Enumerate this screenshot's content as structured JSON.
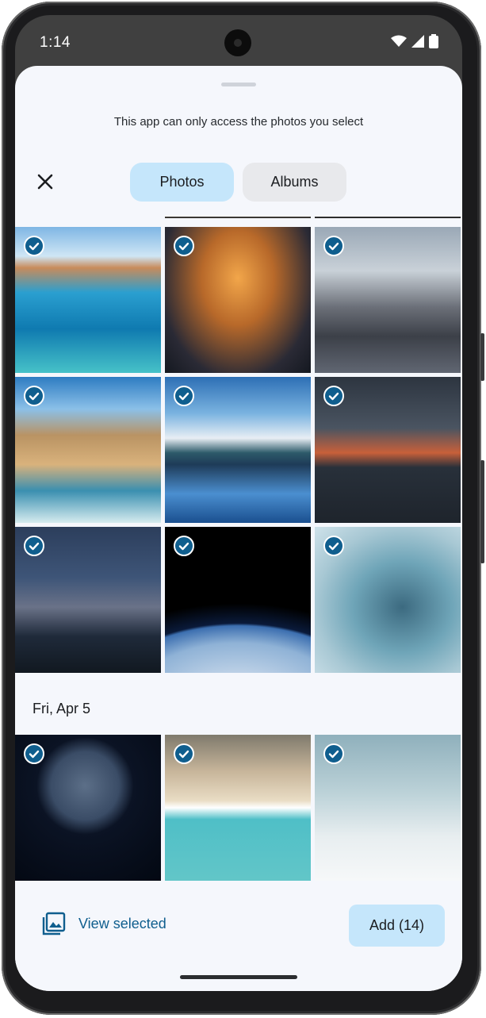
{
  "status": {
    "time": "1:14",
    "icons": [
      "wifi-icon",
      "signal-icon",
      "battery-icon"
    ]
  },
  "sheet": {
    "notice": "This app can only access the photos you select",
    "close_icon": "close-icon",
    "tabs": [
      {
        "label": "Photos",
        "selected": true
      },
      {
        "label": "Albums",
        "selected": false
      }
    ]
  },
  "photos": [
    {
      "subject": "Venice canal with boats",
      "selected": true
    },
    {
      "subject": "City lights aerial at night",
      "selected": true
    },
    {
      "subject": "Bridge and skyline",
      "selected": true
    },
    {
      "subject": "Coastal cliffs and beach",
      "selected": true
    },
    {
      "subject": "Snowy mountains reflected in lake",
      "selected": true
    },
    {
      "subject": "Stormy sunset over harbor",
      "selected": true
    },
    {
      "subject": "Lightning over city",
      "selected": true
    },
    {
      "subject": "Earth from orbit",
      "selected": true
    },
    {
      "subject": "Satellite over icy landscape",
      "selected": true
    }
  ],
  "section": {
    "date": "Fri, Apr 5"
  },
  "photos_apr5": [
    {
      "subject": "Planet in starry space",
      "selected": true
    },
    {
      "subject": "Aerial beach waves",
      "selected": true
    },
    {
      "subject": "Bridge tower in fog",
      "selected": true
    }
  ],
  "bottom": {
    "view_selected_label": "View selected",
    "add_label": "Add (14)"
  },
  "colors": {
    "accent": "#0f5e8e",
    "tab_selected": "#c5e6fb",
    "sheet_bg": "#f5f7fc"
  }
}
